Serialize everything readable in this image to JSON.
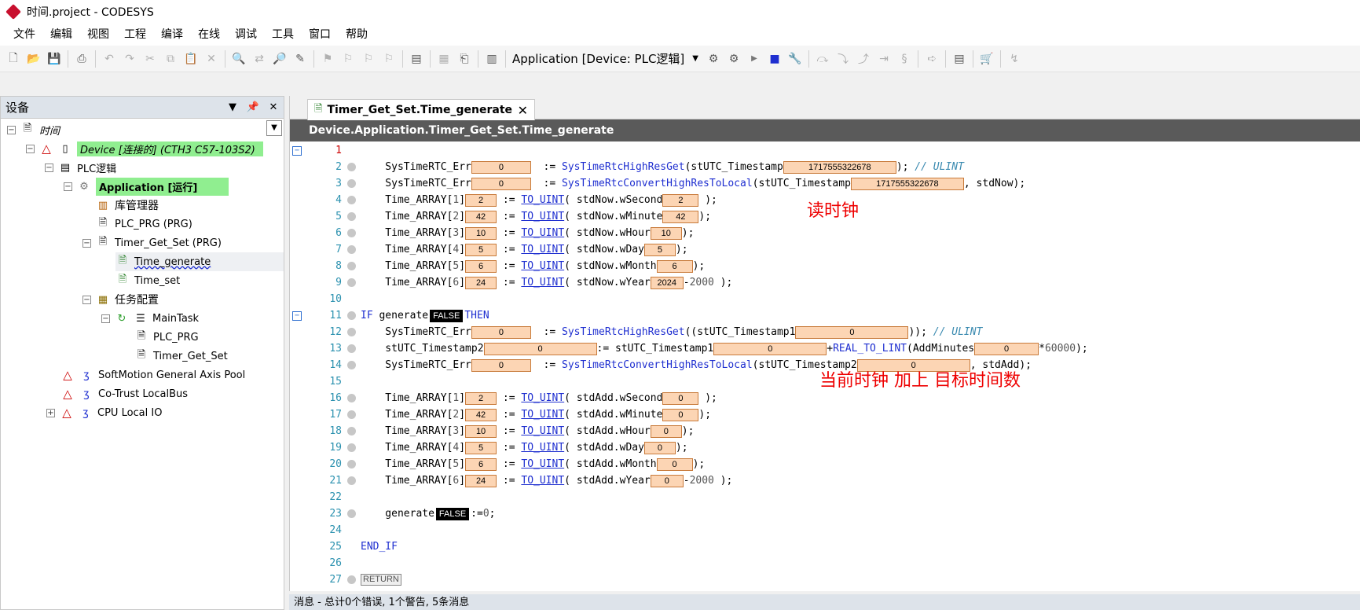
{
  "titlebar": {
    "title": "时间.project - CODESYS"
  },
  "menu": [
    "文件",
    "编辑",
    "视图",
    "工程",
    "编译",
    "在线",
    "调试",
    "工具",
    "窗口",
    "帮助"
  ],
  "toolbar": {
    "app_select": "Application [Device: PLC逻辑]"
  },
  "left_panel": {
    "header": "设备",
    "tree": {
      "root": "时间",
      "device": "Device [连接的] (CTH3 C57-103S2)",
      "plc": "PLC逻辑",
      "application": "Application [运行]",
      "library": "库管理器",
      "plc_prg": "PLC_PRG (PRG)",
      "timer_prg": "Timer_Get_Set (PRG)",
      "time_generate": "Time_generate",
      "time_set": "Time_set",
      "task_config": "任务配置",
      "main_task": "MainTask",
      "task_plc_prg": "PLC_PRG",
      "task_timer": "Timer_Get_Set",
      "softmotion": "SoftMotion General Axis Pool",
      "cotrust": "Co-Trust LocalBus",
      "cpu_io": "CPU Local IO"
    }
  },
  "editor": {
    "tab": "Timer_Get_Set.Time_generate",
    "path": "Device.Application.Timer_Get_Set.Time_generate",
    "line_numbers": [
      "1",
      "2",
      "3",
      "4",
      "5",
      "6",
      "7",
      "8",
      "9",
      "10",
      "11",
      "12",
      "13",
      "14",
      "15",
      "16",
      "17",
      "18",
      "19",
      "20",
      "21",
      "22",
      "23",
      "24",
      "25",
      "26",
      "27"
    ],
    "values": {
      "err2": "0",
      "ts2": "1717555322678",
      "err3": "0",
      "ts3": "1717555322678",
      "sec4": "2",
      "sec4b": "2",
      "min5": "42",
      "min5b": "42",
      "hour6": "10",
      "hour6b": "10",
      "day7": "5",
      "day7b": "5",
      "mon8": "6",
      "mon8b": "6",
      "year9": "24",
      "year9b": "2024",
      "gen11": "FALSE",
      "err12": "0",
      "ts1_12": "0",
      "ts2_13": "0",
      "ts1_13": "0",
      "addmin13": "0",
      "err14": "0",
      "ts2_14": "0",
      "sec16": "2",
      "sec16b": "0",
      "min17": "42",
      "min17b": "0",
      "hour18": "10",
      "hour18b": "0",
      "day19": "5",
      "day19b": "0",
      "mon20": "6",
      "mon20b": "0",
      "year21": "24",
      "year21b": "0",
      "gen23": "FALSE",
      "ret": "RETURN"
    },
    "notes": {
      "read_clock": "读时钟",
      "add_time": "当前时钟 加上 目标时间数"
    }
  },
  "messages": {
    "summary": "消息 - 总计0个错误, 1个警告, 5条消息"
  }
}
